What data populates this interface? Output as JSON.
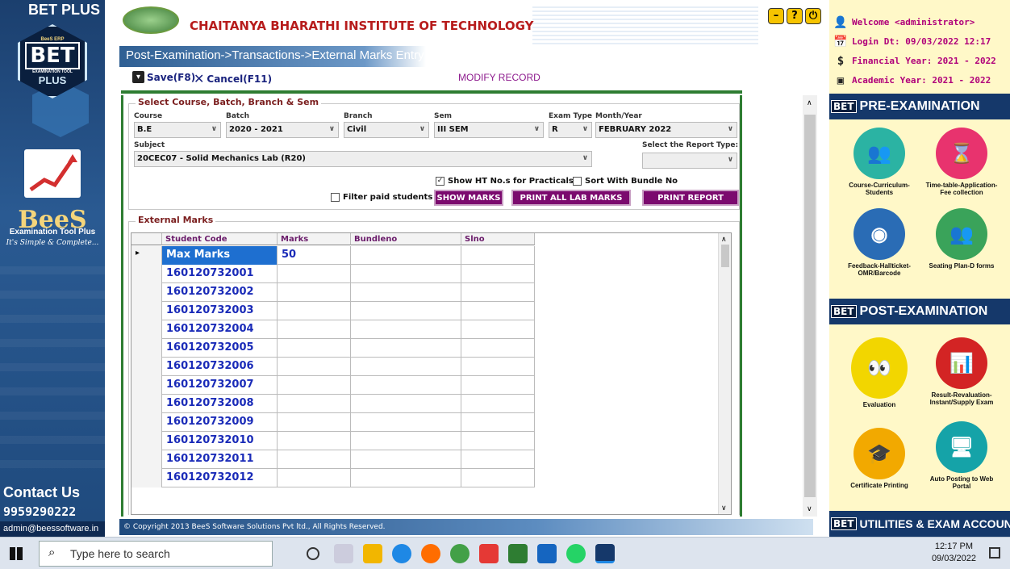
{
  "sidebar": {
    "title": "BET PLUS",
    "logo_badge": "BeeS ERP",
    "logo_main": "BET",
    "logo_sub": "EXAMINATION TOOL",
    "logo_plus": "PLUS",
    "brand": "BeeS",
    "brand_sub": "Examination Tool Plus",
    "tagline": "It's Simple & Complete...",
    "contact_title": "Contact Us",
    "phone": "9959290222",
    "email": "admin@beessoftware.in"
  },
  "header": {
    "institute": "CHAITANYA BHARATHI INSTITUTE OF TECHNOLOGY",
    "breadcrumb": "Post-Examination->Transactions->External Marks Entry",
    "save_label": "Save(F8)",
    "cancel_label": "Cancel(F11)",
    "mode": "MODIFY RECORD"
  },
  "selection": {
    "group_title": "Select Course, Batch, Branch & Sem",
    "course_label": "Course",
    "course_value": "B.E",
    "batch_label": "Batch",
    "batch_value": "2020 - 2021",
    "branch_label": "Branch",
    "branch_value": "Civil",
    "sem_label": "Sem",
    "sem_value": "III SEM",
    "exam_type_label": "Exam Type",
    "exam_type_value": "R",
    "month_year_label": "Month/Year",
    "month_year_value": "FEBRUARY 2022",
    "subject_label": "Subject",
    "subject_value": "20CEC07 - Solid Mechanics Lab (R20)",
    "report_type_label": "Select the Report Type:",
    "report_type_value": "",
    "show_ht_label": "Show HT No.s for Practicals",
    "sort_bundle_label": "Sort With Bundle No",
    "filter_paid_label": "Filter paid students",
    "show_marks_button": "SHOW MARKS",
    "print_all_button": "PRINT ALL LAB MARKS",
    "print_report_button": "PRINT REPORT"
  },
  "marks": {
    "group_title": "External Marks",
    "columns": [
      "Student Code",
      "Marks",
      "Bundleno",
      "Slno"
    ],
    "rows": [
      [
        "Max Marks",
        "50",
        "",
        ""
      ],
      [
        "160120732001",
        "",
        "",
        ""
      ],
      [
        "160120732002",
        "",
        "",
        ""
      ],
      [
        "160120732003",
        "",
        "",
        ""
      ],
      [
        "160120732004",
        "",
        "",
        ""
      ],
      [
        "160120732005",
        "",
        "",
        ""
      ],
      [
        "160120732006",
        "",
        "",
        ""
      ],
      [
        "160120732007",
        "",
        "",
        ""
      ],
      [
        "160120732008",
        "",
        "",
        ""
      ],
      [
        "160120732009",
        "",
        "",
        ""
      ],
      [
        "160120732010",
        "",
        "",
        ""
      ],
      [
        "160120732011",
        "",
        "",
        ""
      ],
      [
        "160120732012",
        "",
        "",
        ""
      ]
    ]
  },
  "footer": "© Copyright 2013 BeeS Software Solutions Pvt ltd., All Rights Reserved.",
  "right_panel": {
    "welcome": "Welcome <administrator>",
    "login": "Login Dt: 09/03/2022 12:17",
    "financial": "Financial Year: 2021 - 2022",
    "academic": "Academic Year: 2021 - 2022",
    "pre_exam": "PRE-EXAMINATION",
    "post_exam": "POST-EXAMINATION",
    "utilities": "UTILITIES & EXAM ACCOUNT",
    "badge": "BET",
    "pre_modules": [
      "Course-Curriculum-Students",
      "Time-table-Application-Fee collection",
      "Feedback-Hallticket-OMR/Barcode",
      "Seating Plan-D forms"
    ],
    "post_modules": [
      "Evaluation",
      "Result-Revaluation-Instant/Supply Exam",
      "Certificate Printing",
      "Auto Posting to Web Portal"
    ]
  },
  "taskbar": {
    "search_placeholder": "Type here to search",
    "time": "12:17 PM",
    "date": "09/03/2022"
  },
  "colors": {
    "accent": "#7b0a6e",
    "brand": "#15386a",
    "link": "#1a2bb8"
  }
}
